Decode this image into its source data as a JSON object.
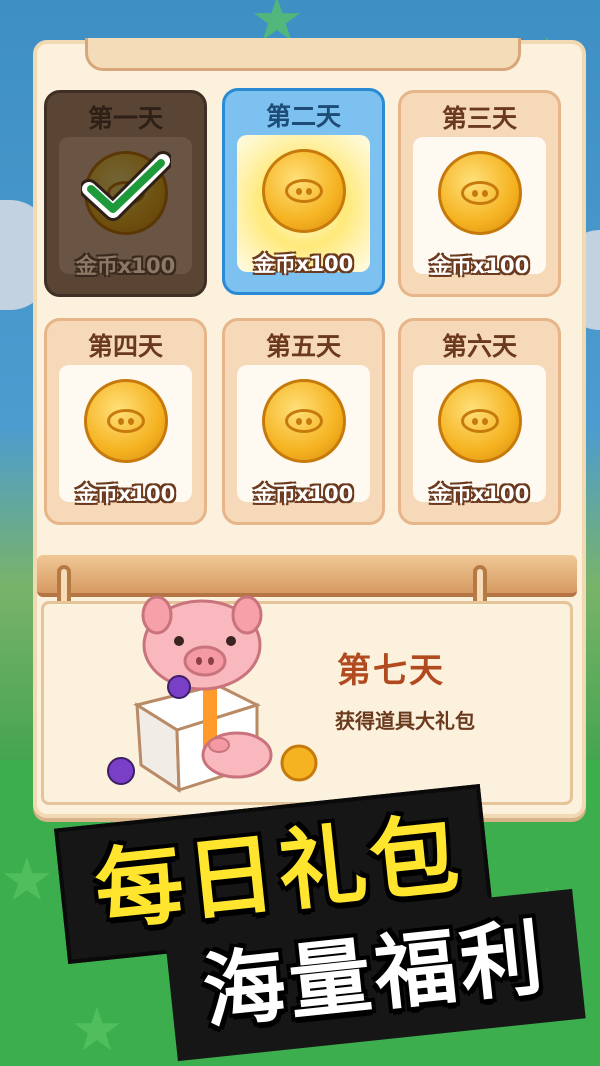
{
  "days": [
    {
      "label": "第一天",
      "reward": "金币x100",
      "state": "claimed"
    },
    {
      "label": "第二天",
      "reward": "金币x100",
      "state": "active"
    },
    {
      "label": "第三天",
      "reward": "金币x100",
      "state": "normal"
    },
    {
      "label": "第四天",
      "reward": "金币x100",
      "state": "normal"
    },
    {
      "label": "第五天",
      "reward": "金币x100",
      "state": "normal"
    },
    {
      "label": "第六天",
      "reward": "金币x100",
      "state": "normal"
    }
  ],
  "day7": {
    "label": "第七天",
    "reward": "获得道具大礼包"
  },
  "banner": {
    "line1": "每日礼包",
    "line2": "海量福利"
  },
  "icons": {
    "coin": "pig-coin-icon",
    "check": "checkmark-icon",
    "gift": "pig-gift-box-icon"
  },
  "colors": {
    "accent": "#ffe52e",
    "active_border": "#2a8ad3",
    "claimed": "#5a4535"
  }
}
